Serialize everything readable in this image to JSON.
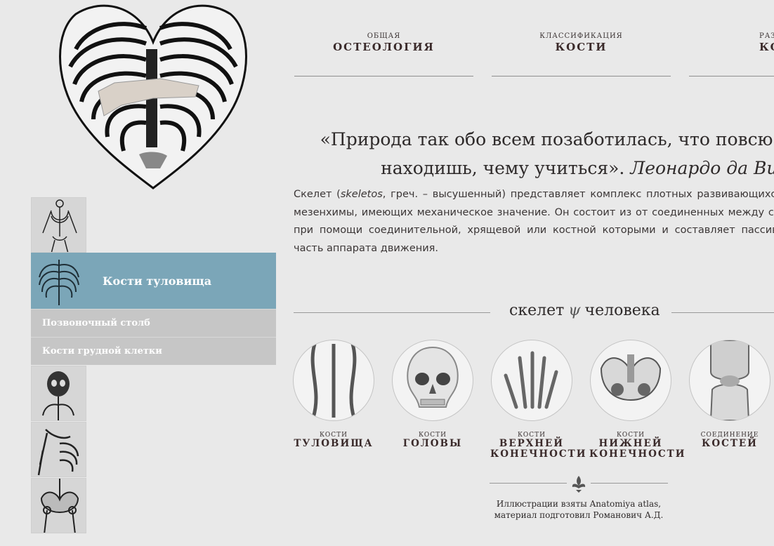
{
  "nav": [
    {
      "small": "ОБЩАЯ",
      "big": "ОСТЕОЛОГИЯ"
    },
    {
      "small": "КЛАССИФИКАЦИЯ",
      "big": "КОСТИ"
    },
    {
      "small": "РАЗ",
      "big": "КО"
    }
  ],
  "quote": {
    "line1": "«Природа так обо всем позаботилась, что повсю",
    "line2_text": "находишь, чему учиться».",
    "author": "Леонардо да Вин"
  },
  "body": {
    "before_em": "Скелет (",
    "em": "skeletos",
    "after_em": ", греч. – высушенный) представляет комплекс плотных развивающихся из мезенхимы, имеющих механическое значение. Он состоит из от соединенных между собой при помощи соединительной, хрящевой или костной которыми и составляет пассивную часть аппарата движения."
  },
  "sidebar": {
    "active_label": "Кости туловища",
    "sub_items": [
      "Позвоночный столб",
      "Кости грудной клетки"
    ]
  },
  "section": {
    "left": "скелет",
    "symbol": "ψ",
    "right": "человека"
  },
  "categories": [
    {
      "small": "КОСТИ",
      "big1": "ТУЛОВИЩА",
      "big2": ""
    },
    {
      "small": "КОСТИ",
      "big1": "ГОЛОВЫ",
      "big2": ""
    },
    {
      "small": "КОСТИ",
      "big1": "ВЕРХНЕЙ",
      "big2": "КОНЕЧНОСТИ"
    },
    {
      "small": "КОСТИ",
      "big1": "НИЖНЕЙ",
      "big2": "КОНЕЧНОСТИ"
    },
    {
      "small": "СОЕДИНЕНИЕ",
      "big1": "КОСТЕЙ",
      "big2": ""
    }
  ],
  "footer": {
    "line1": "Иллюстрации взяты Anatomiya atlas,",
    "line2": "материал подготовил Романович А.Д."
  },
  "icons": {
    "heart": "ribcage-heart-icon",
    "ornament": "fleur-de-lis-icon"
  }
}
